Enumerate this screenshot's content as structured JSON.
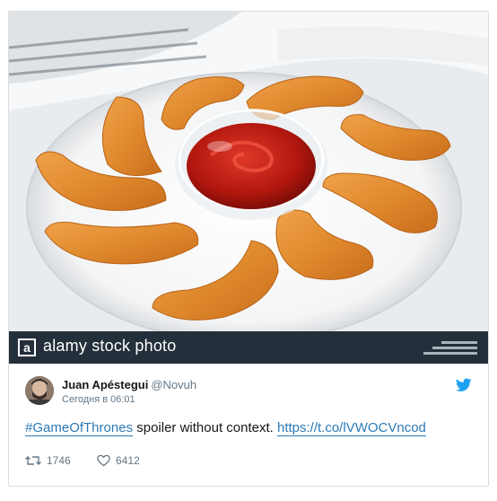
{
  "media": {
    "watermark_logo": "a",
    "watermark_text": "alamy stock photo",
    "watermark_color": "#232f3a"
  },
  "tweet": {
    "author_name": "Juan Apéstegui",
    "author_handle": "@Novuh",
    "timestamp": "Сегодня в 06:01",
    "hashtag": "#GameOfThrones",
    "body_text": " spoiler without context. ",
    "link_text": "https://t.co/lVWOCVncod",
    "retweet_count": "1746",
    "like_count": "6412",
    "link_color": "#2b7bb9",
    "twitter_blue": "#1da1f2",
    "icons": [
      "twitter-bird-icon",
      "retweet-icon",
      "heart-icon"
    ]
  }
}
